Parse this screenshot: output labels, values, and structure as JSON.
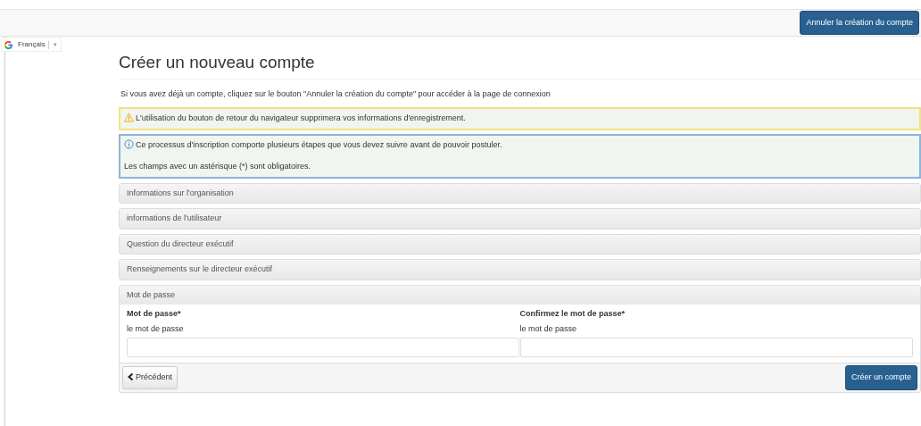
{
  "navbar": {
    "cancel_button": "Annuler la création du compte"
  },
  "translate": {
    "language": "Français",
    "caret": "▼"
  },
  "title": "Créer un nouveau compte",
  "intro": "Si vous avez déjà un compte, cliquez sur le bouton \"Annuler la création du compte\" pour accéder à la page de connexion",
  "alerts": [
    {
      "kind": "warning",
      "lines": [
        "L'utilisation du bouton de retour du navigateur supprimera vos informations d'enregistrement."
      ]
    },
    {
      "kind": "info",
      "lines": [
        "Ce processus d'inscription comporte plusieurs étapes que vous devez suivre avant de pouvoir postuler.",
        "Les champs avec un astérisque (*) sont obligatoires."
      ]
    }
  ],
  "sections": [
    {
      "title": "Informations sur l'organisation",
      "expanded": false
    },
    {
      "title": "informations de l'utilisateur",
      "expanded": false
    },
    {
      "title": "Question du directeur exécutif",
      "expanded": false
    },
    {
      "title": "Renseignements sur le directeur exécutif",
      "expanded": false
    },
    {
      "title": "Mot de passe",
      "expanded": true,
      "fields": [
        {
          "label": "Mot de passe*",
          "hint": "le mot de passe"
        },
        {
          "label": "Confirmez le mot de passe*",
          "hint": "le mot de passe"
        }
      ],
      "back_button": "Précédent",
      "submit_button": "Créer un compte"
    }
  ]
}
